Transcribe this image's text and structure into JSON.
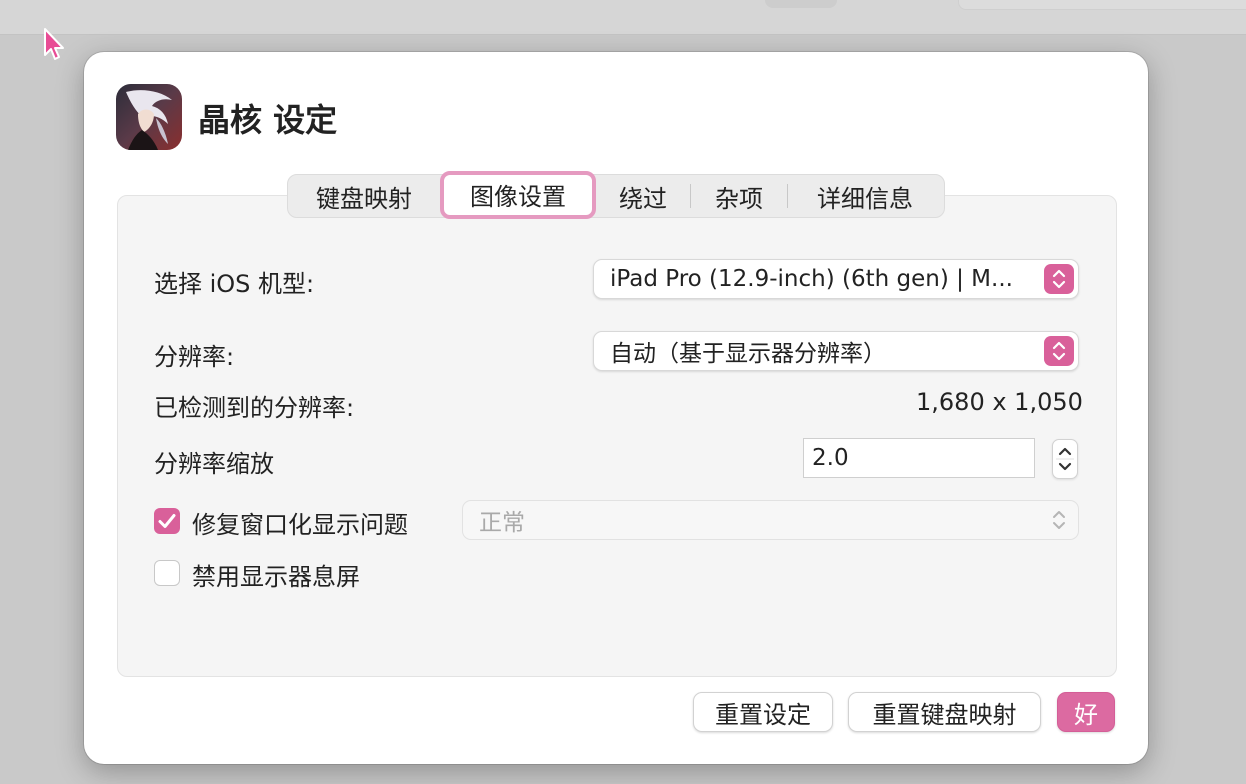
{
  "dialog": {
    "title": "晶核 设定",
    "app_icon": "game-app-icon"
  },
  "tabs": [
    {
      "label": "键盘映射",
      "selected": false
    },
    {
      "label": "图像设置",
      "selected": true
    },
    {
      "label": "绕过",
      "selected": false
    },
    {
      "label": "杂项",
      "selected": false
    },
    {
      "label": "详细信息",
      "selected": false
    }
  ],
  "settings": {
    "ios_model_label": "选择 iOS 机型:",
    "ios_model_value": "iPad Pro (12.9-inch) (6th gen) | M...",
    "resolution_label": "分辨率:",
    "resolution_value": "自动（基于显示器分辨率）",
    "detected_label": "已检测到的分辨率:",
    "detected_value": "1,680 x 1,050",
    "scale_label": "分辨率缩放",
    "scale_value": "2.0",
    "fix_window_label": "修复窗口化显示问题",
    "fix_window_checked": true,
    "fix_window_mode": "正常",
    "disable_sleep_label": "禁用显示器息屏",
    "disable_sleep_checked": false
  },
  "buttons": {
    "reset_settings": "重置设定",
    "reset_keymap": "重置键盘映射",
    "ok": "好"
  },
  "colors": {
    "accent": "#d9609a",
    "tab_highlight": "#e59ac0"
  }
}
